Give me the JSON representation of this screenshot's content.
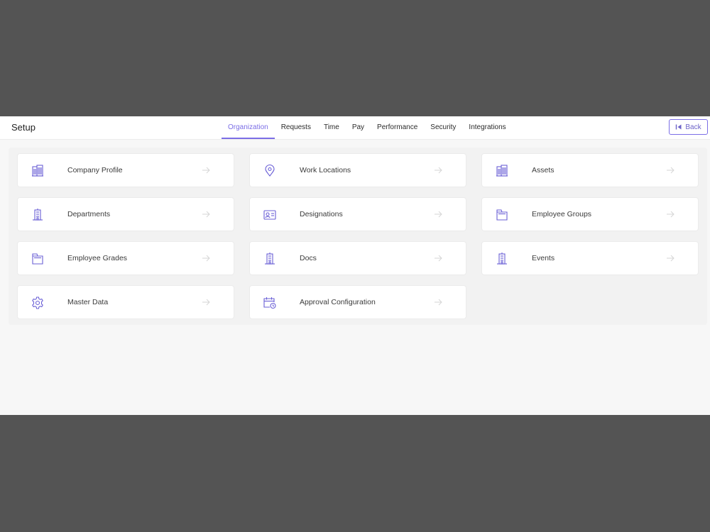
{
  "header": {
    "title": "Setup",
    "back_label": "Back"
  },
  "tabs": [
    {
      "label": "Organization",
      "active": true
    },
    {
      "label": "Requests",
      "active": false
    },
    {
      "label": "Time",
      "active": false
    },
    {
      "label": "Pay",
      "active": false
    },
    {
      "label": "Performance",
      "active": false
    },
    {
      "label": "Security",
      "active": false
    },
    {
      "label": "Integrations",
      "active": false
    }
  ],
  "cards": [
    {
      "label": "Company Profile",
      "icon": "office-building-icon"
    },
    {
      "label": "Work Locations",
      "icon": "map-pin-icon"
    },
    {
      "label": "Assets",
      "icon": "office-building-icon"
    },
    {
      "label": "Departments",
      "icon": "tower-building-icon"
    },
    {
      "label": "Designations",
      "icon": "id-card-icon"
    },
    {
      "label": "Employee Groups",
      "icon": "folder-icon"
    },
    {
      "label": "Employee Grades",
      "icon": "folder-icon"
    },
    {
      "label": "Docs",
      "icon": "tower-building-icon"
    },
    {
      "label": "Events",
      "icon": "tower-building-icon"
    },
    {
      "label": "Master Data",
      "icon": "gear-icon"
    },
    {
      "label": "Approval Configuration",
      "icon": "calendar-clock-icon"
    }
  ],
  "colors": {
    "accent": "#7b6ee6",
    "icon": "#6a5fd6",
    "arrow": "#d6d6d6",
    "backdrop": "#545454"
  }
}
